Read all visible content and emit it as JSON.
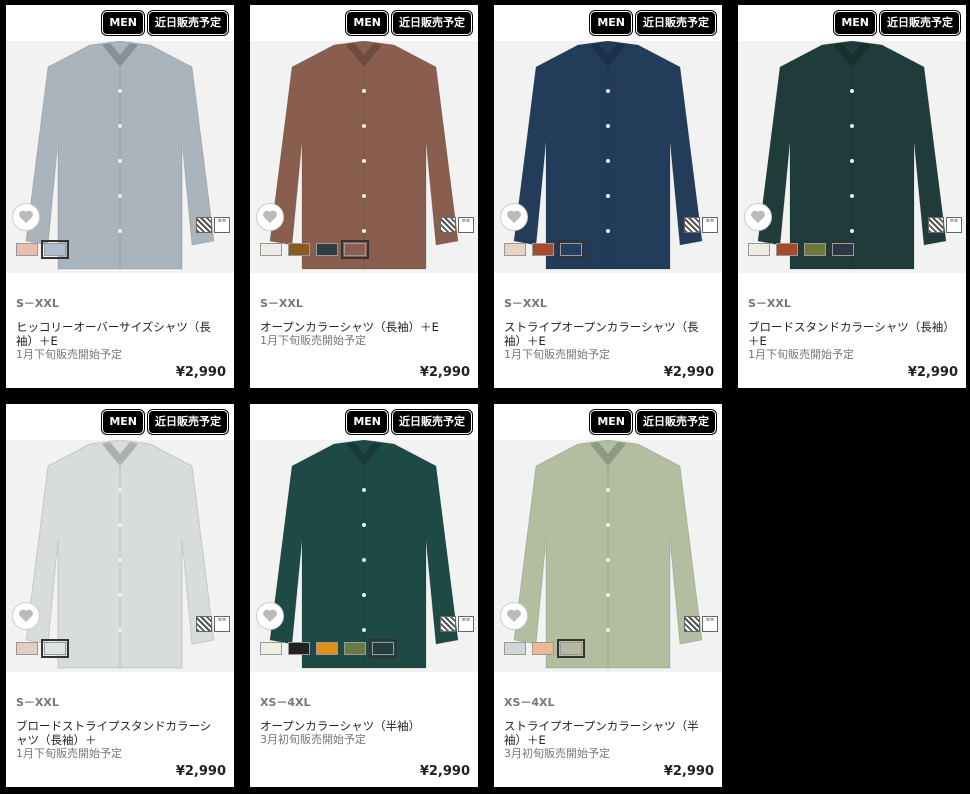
{
  "products": [
    {
      "badge_gender": "MEN",
      "badge_status": "近日販売予定",
      "size": "S－XXL",
      "name": "ヒッコリーオーバーサイズシャツ（長袖）＋E",
      "release": "1月下旬販売開始予定",
      "price": "¥2,990",
      "shirt_color": "#a9b4bc",
      "swatches": [
        "#e8bfae",
        "#aebccc"
      ],
      "selected": 1
    },
    {
      "badge_gender": "MEN",
      "badge_status": "近日販売予定",
      "size": "S－XXL",
      "name": "オープンカラーシャツ（長袖）＋E",
      "release": "1月下旬販売開始予定",
      "price": "¥2,990",
      "shirt_color": "#8a5e4e",
      "swatches": [
        "#eeece4",
        "#8a5a1e",
        "#2e3d44",
        "#8a5e55"
      ],
      "selected": 3
    },
    {
      "badge_gender": "MEN",
      "badge_status": "近日販売予定",
      "size": "S－XXL",
      "name": "ストライプオープンカラーシャツ（長袖）＋E",
      "release": "1月下旬販売開始予定",
      "price": "¥2,990",
      "shirt_color": "#233c5a",
      "swatches": [
        "#e9d3bf",
        "#a84a2e",
        "#25405c"
      ],
      "selected": 2
    },
    {
      "badge_gender": "MEN",
      "badge_status": "近日販売予定",
      "size": "S－XXL",
      "name": "ブロードスタンドカラーシャツ（長袖）＋E",
      "release": "1月下旬販売開始予定",
      "price": "¥2,990",
      "shirt_color": "#1f3b3a",
      "swatches": [
        "#eeede4",
        "#a84a2a",
        "#6b7a3a",
        "#283844"
      ],
      "selected": 3
    },
    {
      "badge_gender": "MEN",
      "badge_status": "近日販売予定",
      "size": "S－XXL",
      "name": "ブロードストライプスタンドカラーシャツ（長袖）＋",
      "release": "1月下旬販売開始予定",
      "price": "¥2,990",
      "shirt_color": "#d8dcdc",
      "swatches": [
        "#e2cfbf",
        "#dfe2e2"
      ],
      "selected": 1
    },
    {
      "badge_gender": "MEN",
      "badge_status": "近日販売予定",
      "size": "XS－4XL",
      "name": "オープンカラーシャツ（半袖）",
      "release": "3月初旬販売開始予定",
      "price": "¥2,990",
      "shirt_color": "#1d4a44",
      "swatches": [
        "#efefe6",
        "#222222",
        "#e09018",
        "#6b7a44",
        "#203e3e"
      ],
      "selected": 4
    },
    {
      "badge_gender": "MEN",
      "badge_status": "近日販売予定",
      "size": "XS－4XL",
      "name": "ストライプオープンカラーシャツ（半袖）＋E",
      "release": "3月初旬販売開始予定",
      "price": "¥2,990",
      "shirt_color": "#b3bea0",
      "swatches": [
        "#cfd6da",
        "#ecb896",
        "#b8b7a0"
      ],
      "selected": 2
    }
  ]
}
